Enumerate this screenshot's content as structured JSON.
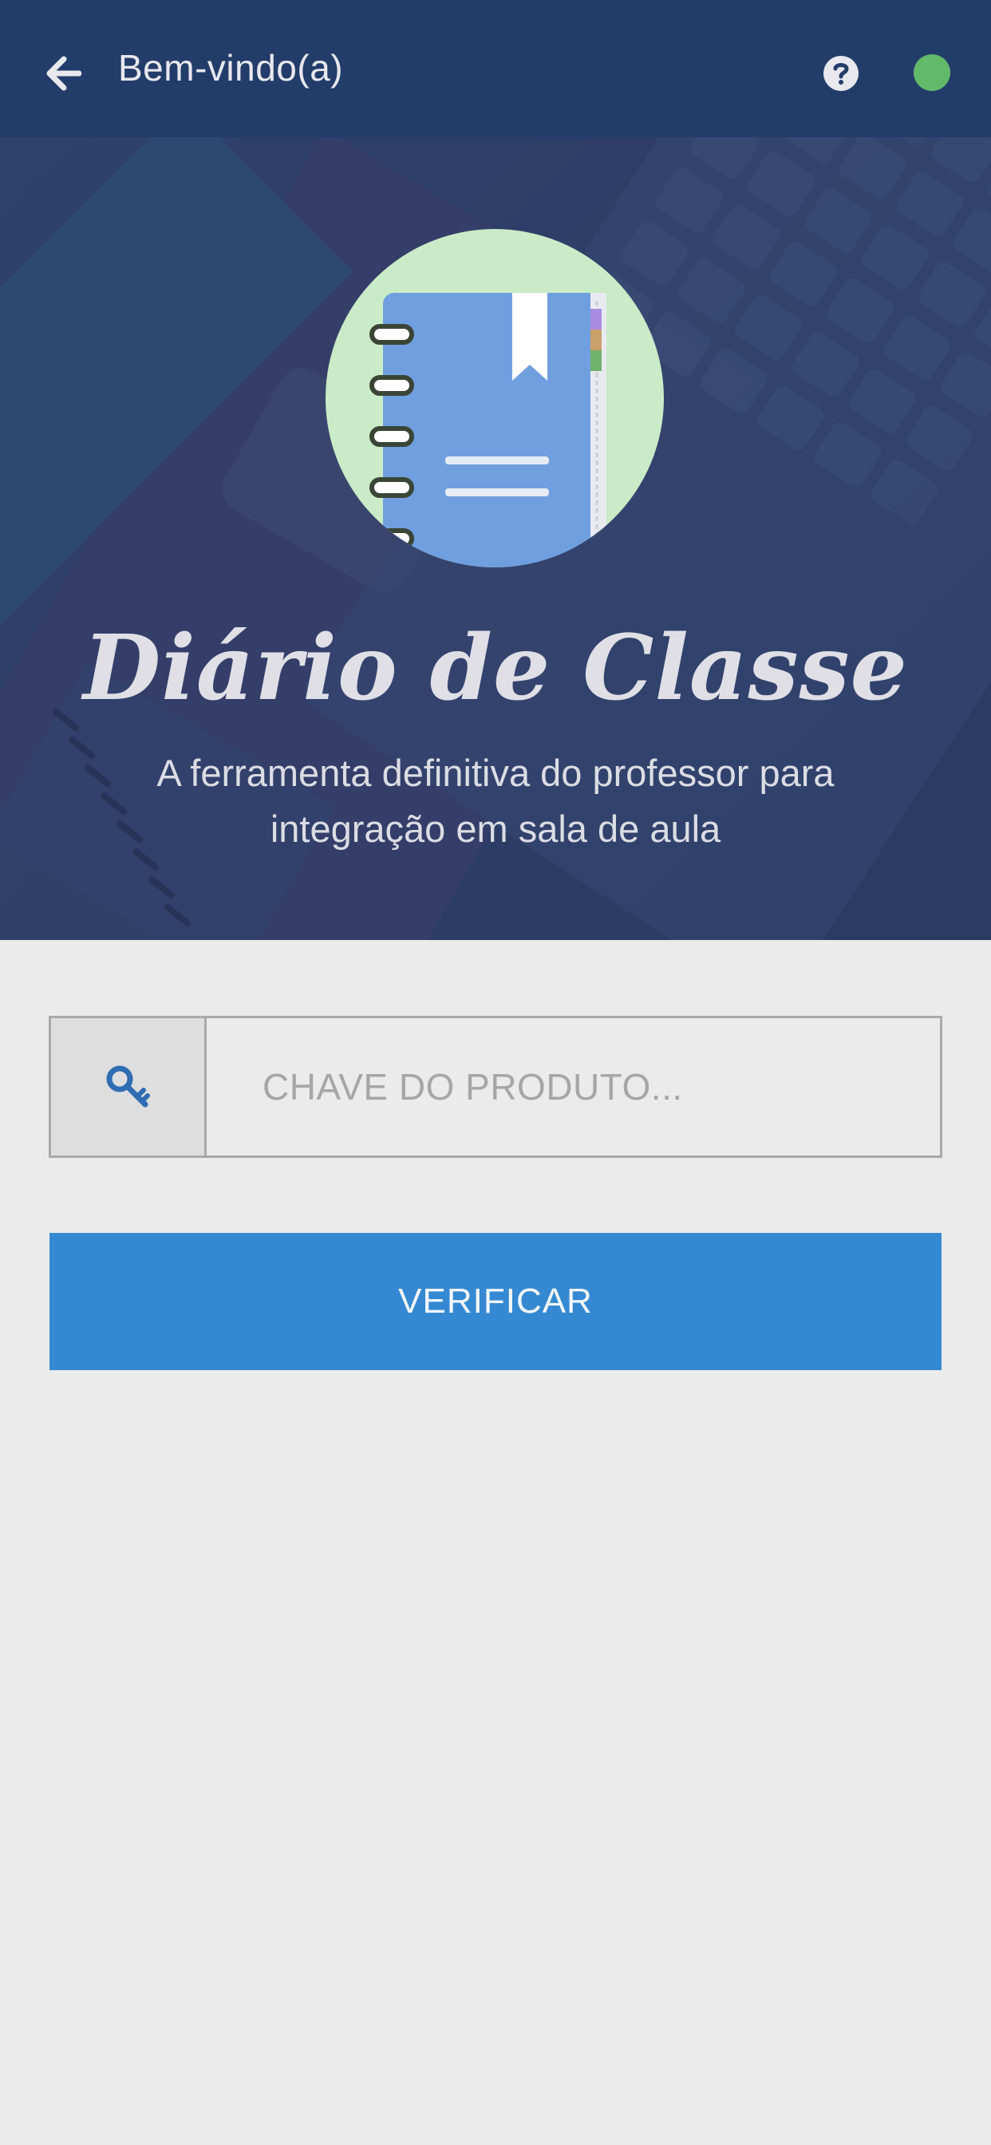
{
  "header": {
    "back_icon": "arrow-left-icon",
    "title": "Bem-vindo(a)",
    "help_icon": "question-circle-icon",
    "status_color": "#62b96a"
  },
  "hero": {
    "logo_icon": "notebook-icon",
    "app_name": "Diário de Classe",
    "tagline_line1": "A ferramenta definitiva do professor para",
    "tagline_line2": "integração em sala de aula"
  },
  "form": {
    "key_icon": "key-icon",
    "product_key_placeholder": "CHAVE DO PRODUTO...",
    "product_key_value": "",
    "verify_label": "VERIFICAR"
  },
  "colors": {
    "appbar": "#233d6a",
    "accent": "#3589d2",
    "background": "#ebebeb"
  }
}
